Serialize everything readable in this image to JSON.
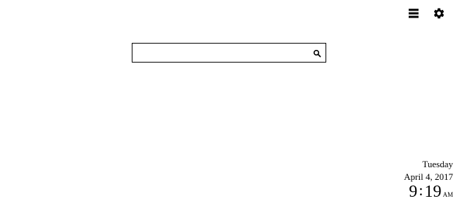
{
  "toolbar": {
    "menu_icon": "hamburger-menu-icon",
    "settings_icon": "gear-icon"
  },
  "search": {
    "value": "",
    "placeholder": "",
    "button_icon": "search-icon"
  },
  "clock": {
    "weekday": "Tuesday",
    "date": "April 4, 2017",
    "hours": "9",
    "minutes": "19",
    "ampm": "AM"
  }
}
